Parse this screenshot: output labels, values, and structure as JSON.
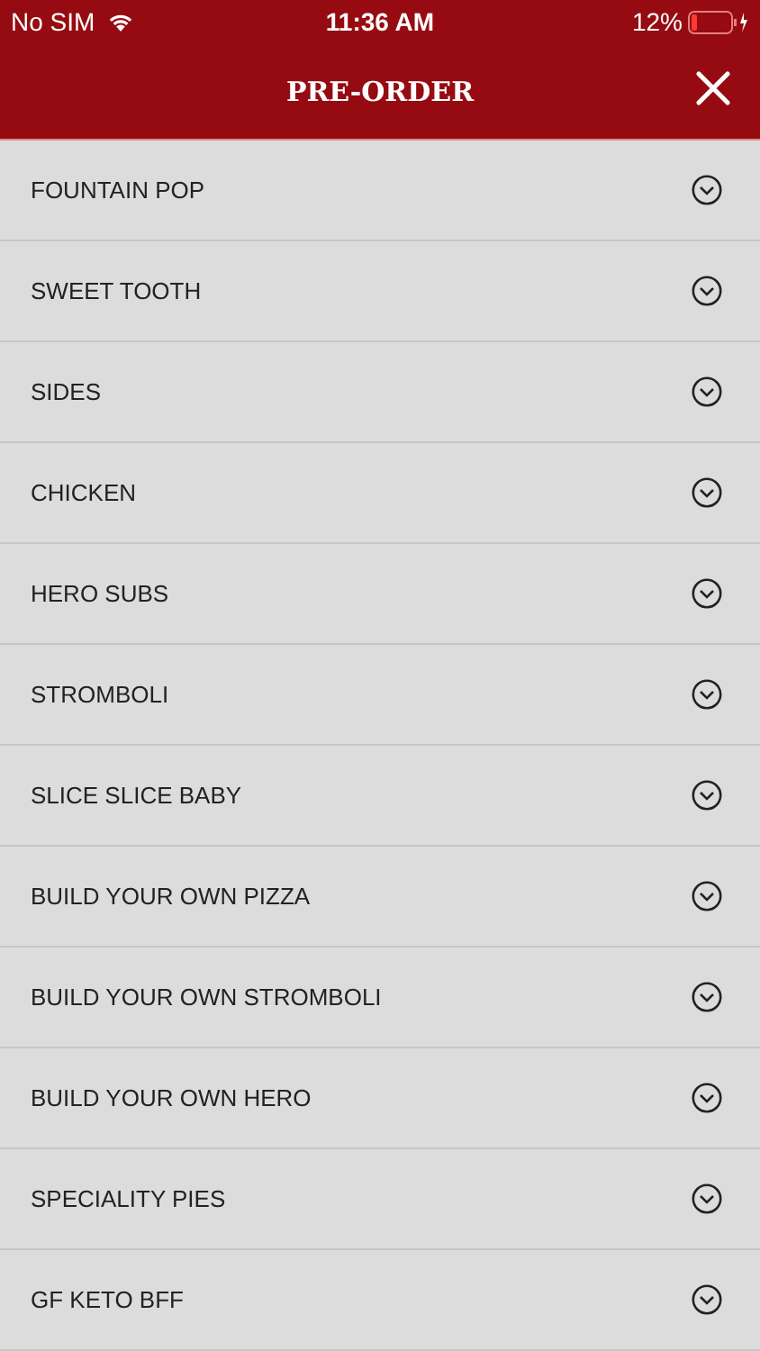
{
  "status_bar": {
    "carrier": "No SIM",
    "time": "11:36 AM",
    "battery": "12%"
  },
  "header": {
    "title": "PRE-ORDER"
  },
  "categories": [
    {
      "label": "FOUNTAIN POP",
      "expanded": false
    },
    {
      "label": "SWEET TOOTH",
      "expanded": false
    },
    {
      "label": "SIDES",
      "expanded": false
    },
    {
      "label": "CHICKEN",
      "expanded": false
    },
    {
      "label": "HERO SUBS",
      "expanded": false
    },
    {
      "label": "STROMBOLI",
      "expanded": false
    },
    {
      "label": "SLICE SLICE BABY",
      "expanded": false
    },
    {
      "label": "BUILD YOUR OWN PIZZA",
      "expanded": false
    },
    {
      "label": "BUILD YOUR OWN STROMBOLI",
      "expanded": false
    },
    {
      "label": "BUILD YOUR OWN HERO",
      "expanded": false
    },
    {
      "label": "SPECIALITY PIES",
      "expanded": false
    },
    {
      "label": "GF KETO BFF",
      "expanded": false
    }
  ]
}
